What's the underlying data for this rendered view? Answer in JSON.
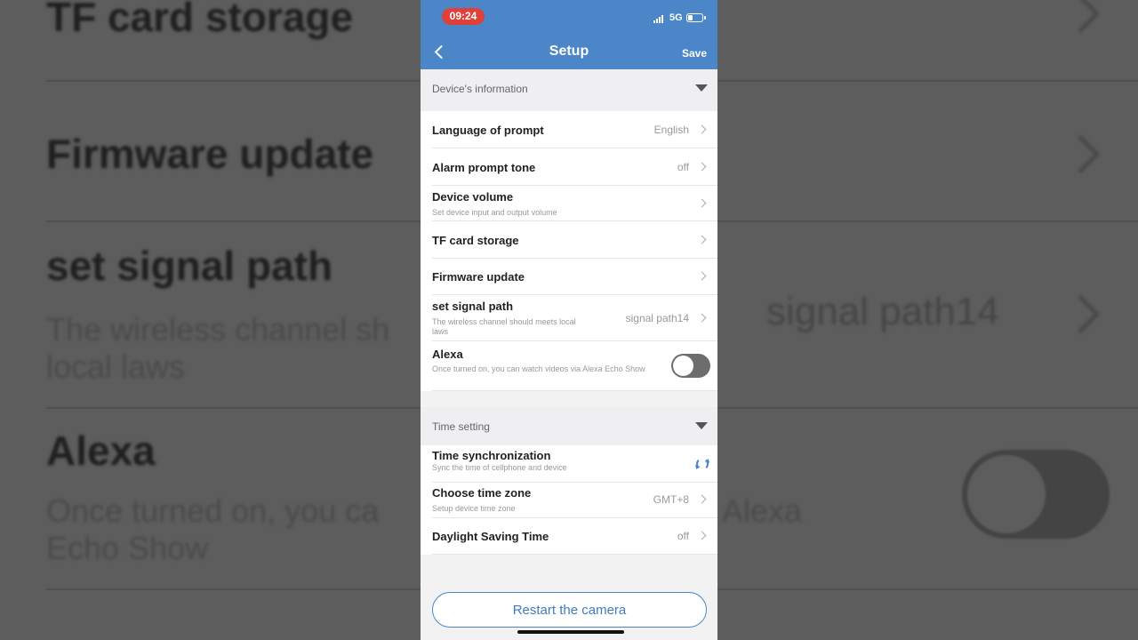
{
  "background": {
    "rows": [
      "TF card storage",
      "Firmware update",
      "set signal path",
      "Alexa"
    ],
    "signal_sub_line1": "The wireless channel sh",
    "signal_sub_line2": "local laws",
    "signal_value": "signal path14",
    "alexa_sub_line1": "Once turned on, you ca",
    "alexa_sub_line1_tail": "Alexa",
    "alexa_sub_line2": "Echo Show"
  },
  "status_bar": {
    "time": "09:24",
    "network": "5G"
  },
  "nav": {
    "title": "Setup",
    "save_label": "Save"
  },
  "sections": {
    "device_info": "Device's information",
    "time_setting": "Time setting"
  },
  "device_rows": {
    "language": {
      "label": "Language of prompt",
      "value": "English"
    },
    "alarm_tone": {
      "label": "Alarm prompt tone",
      "value": "off"
    },
    "device_volume": {
      "label": "Device volume",
      "sub": "Set device input and output volume"
    },
    "tf_card": {
      "label": "TF card storage"
    },
    "firmware": {
      "label": "Firmware update"
    },
    "signal_path": {
      "label": "set signal path",
      "sub": "The wireless channel should meets local laws",
      "value": "signal path14"
    },
    "alexa": {
      "label": "Alexa",
      "sub": "Once turned on, you can watch videos via Alexa Echo Show",
      "enabled": false
    }
  },
  "time_rows": {
    "sync": {
      "label": "Time synchronization",
      "sub": "Sync the time of cellphone and device"
    },
    "timezone": {
      "label": "Choose time zone",
      "sub": "Setup device time zone",
      "value": "GMT+8"
    },
    "dst": {
      "label": "Daylight Saving Time",
      "value": "off"
    }
  },
  "restart_label": "Restart the camera",
  "colors": {
    "nav_blue": "#4a86c8",
    "time_pill_red": "#e0403a",
    "toggle_off": "#6d6d6d"
  }
}
